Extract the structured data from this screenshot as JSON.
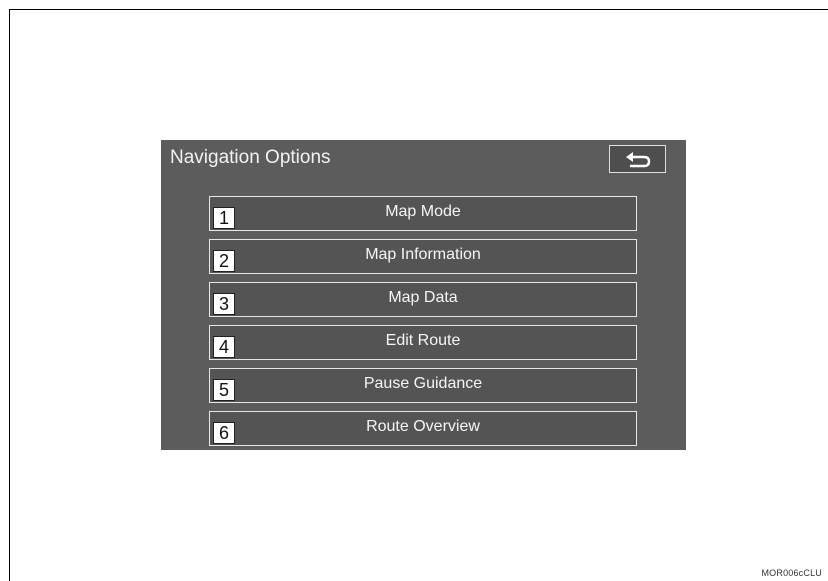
{
  "screen": {
    "title": "Navigation Options",
    "back_icon": "back-arrow-icon",
    "options": [
      {
        "number": "1",
        "label": "Map Mode"
      },
      {
        "number": "2",
        "label": "Map Information"
      },
      {
        "number": "3",
        "label": "Map Data"
      },
      {
        "number": "4",
        "label": "Edit Route"
      },
      {
        "number": "5",
        "label": "Pause Guidance"
      },
      {
        "number": "6",
        "label": "Route Overview"
      }
    ]
  },
  "colors": {
    "screen_background": "#5c5c5c",
    "text": "#f2f2f2",
    "button_border": "#e6e6e6"
  },
  "image_code": "MOR006cCLU"
}
